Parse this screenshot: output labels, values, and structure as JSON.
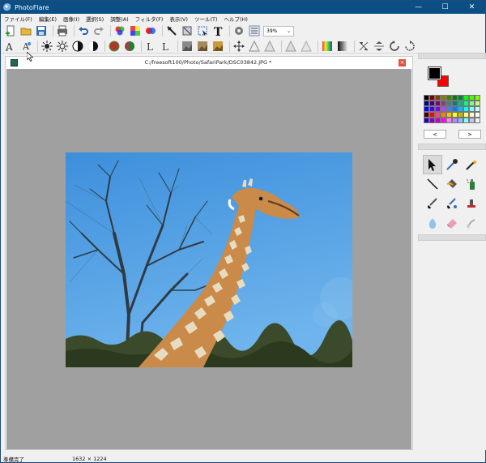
{
  "window": {
    "title": "PhotoFlare",
    "min": "—",
    "max": "☐",
    "close": "✕"
  },
  "menu": [
    "ファイル(F)",
    "編集(E)",
    "画像(I)",
    "選択(S)",
    "調整(A)",
    "フィルタ(F)",
    "表示(V)",
    "ツール(T)",
    "ヘルプ(H)"
  ],
  "toolbar": {
    "zoom_value": "39%"
  },
  "document": {
    "path": "C:/freesoft100/Photo/SafariPark/DSC03842.JPG *"
  },
  "palette_nav": {
    "prev": "<",
    "next": ">"
  },
  "colors": {
    "primary": "#000000",
    "secondary": "#ff0000",
    "accent": "#0b4f84"
  },
  "status": {
    "text": "準備完了",
    "dimensions": "1632 × 1224"
  }
}
